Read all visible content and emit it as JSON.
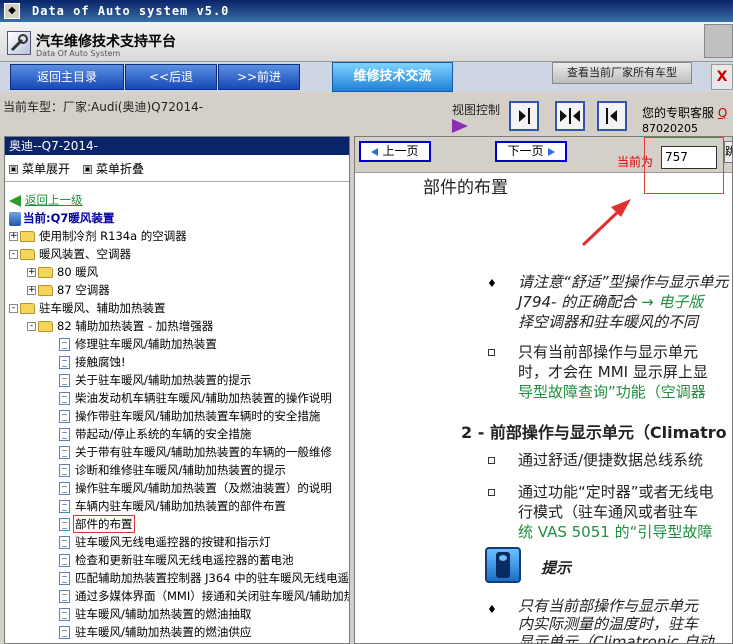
{
  "window": {
    "title": "Data of Auto system v5.0"
  },
  "header": {
    "app_title": "汽车维修技术支持平台",
    "app_subtitle": "Data Of Auto System"
  },
  "toolbar": {
    "back_home": "返回主目录",
    "prev": "<<后退",
    "next": ">>前进",
    "repair_tab": "维修技术交流",
    "view_all": "查看当前厂家所有车型",
    "close": "X"
  },
  "info": {
    "current_model": "当前车型：厂家:Audi(奥迪)Q72014-",
    "view_control": "视图控制",
    "service_text": "您的专职客服",
    "service_link": "Q",
    "phone": "87020205"
  },
  "tree": {
    "header": "奥迪--Q7-2014-",
    "expand_label": "菜单展开",
    "collapse_label": "菜单折叠",
    "back_label": "返回上一级",
    "current_label": "当前:Q7暖风装置",
    "items": [
      {
        "label": "使用制冷剂 R134a 的空调器"
      },
      {
        "label": "暖风装置、空调器"
      },
      {
        "label": "80 暖风"
      },
      {
        "label": "87 空调器"
      },
      {
        "label": "驻车暖风、辅助加热装置"
      },
      {
        "label": "82 辅助加热装置 - 加热增强器"
      }
    ],
    "docs": [
      "修理驻车暖风/辅助加热装置",
      "接触腐蚀!",
      "关于驻车暖风/辅助加热装置的提示",
      "柴油发动机车辆驻车暖风/辅助加热装置的操作说明",
      "操作带驻车暖风/辅助加热装置车辆时的安全措施",
      "带起动/停止系统的车辆的安全措施",
      "关于带有驻车暖风/辅助加热装置的车辆的一般维修",
      "诊断和维修驻车暖风/辅助加热装置的提示",
      "操作驻车暖风/辅助加热装置（及燃油装置）的说明",
      "车辆内驻车暖风/辅助加热装置的部件布置",
      "部件的布置",
      "驻车暖风无线电遥控器的按键和指示灯",
      "检查和更新驻车暖风无线电遥控器的蓄电池",
      "匹配辅助加热装置控制器 J364 中的驻车暖风无线电遥控器",
      "通过多媒体界面（MMI）接通和关闭驻车暖风/辅助加热装置",
      "驻车暖风/辅助加热装置的燃油抽取",
      "驻车暖风/辅助加热装置的燃油供应"
    ]
  },
  "content": {
    "prev_page": "上一页",
    "next_page": "下一页",
    "current_page_label": "当前为",
    "current_page": "757",
    "go": "跳",
    "heading": "部件的布置",
    "p1_line1": "请注意“舒适”型操作与显示单元",
    "p1_line2a": "J794- 的正确配合",
    "p1_line2b": "→ 电子版",
    "p1_line3": "择空调器和驻车暖风的不同",
    "p2_line1": "只有当前部操作与显示单元",
    "p2_line2": "时，才会在 MMI 显示屏上显",
    "p2_line3": "导型故障查询”功能（空调器",
    "section2": "2 - 前部操作与显示单元（Climatro",
    "s2_item1": "通过舒适/便捷数据总线系统",
    "s2_item2_line1": "通过功能“定时器”或者无线电",
    "s2_item2_line2": "行模式（驻车通风或者驻车",
    "s2_item2_line3": "统 VAS 5051 的“引导型故障",
    "note_title": "提示",
    "note_line1": "只有当前部操作与显示单元",
    "note_line2": "内实际测量的温度时，驻车",
    "note_line3": "显示单元（Climatronic 自动"
  },
  "colors": {
    "titlebar": "#0a246a",
    "accent_blue": "#1e7fd8",
    "highlight_red": "#e04040",
    "link_green": "#1f8f3f"
  }
}
